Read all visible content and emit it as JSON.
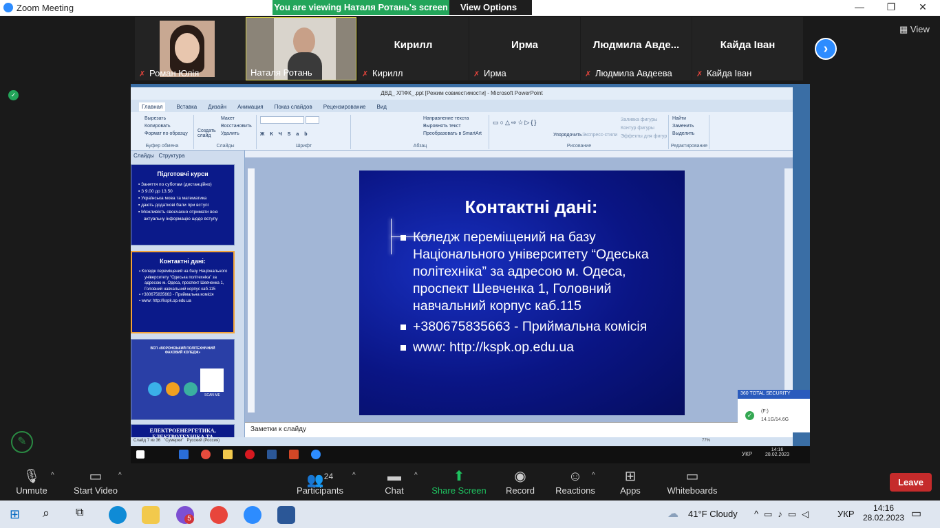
{
  "window": {
    "title": "Zoom Meeting",
    "minimize": "—",
    "restore": "❐",
    "close": "✕"
  },
  "banner": {
    "text": "You are viewing Наталя Ротань's screen",
    "view_options": "View Options"
  },
  "participants_strip": {
    "view_label": "View",
    "tiles": [
      {
        "name": "Роман Юлія",
        "muted": true
      },
      {
        "name": "Наталя Ротань",
        "muted": false
      },
      {
        "name": "Кирилл",
        "big_name": "Кирилл",
        "muted": true
      },
      {
        "name": "Ирма",
        "big_name": "Ирма",
        "muted": true
      },
      {
        "name": "Людмила Авдеева",
        "big_name": "Людмила Авде...",
        "muted": true
      },
      {
        "name": "Кайда Іван",
        "big_name": "Кайда Іван",
        "muted": true
      }
    ]
  },
  "ppt": {
    "title": "ДВД_ ХПФК_.ppt [Режим совместимости] - Microsoft PowerPoint",
    "tabs": [
      "Главная",
      "Вставка",
      "Дизайн",
      "Анимация",
      "Показ слайдов",
      "Рецензирование",
      "Вид"
    ],
    "ribbon_groups": [
      "Буфер обмена",
      "Слайды",
      "Шрифт",
      "Абзац",
      "Рисование",
      "Редактирование"
    ],
    "clipboard": [
      "Вырезать",
      "Копировать",
      "Формат по образцу"
    ],
    "slides_group": [
      "Создать слайд",
      "Макет",
      "Восстановить",
      "Удалить"
    ],
    "editing": [
      "Найти",
      "Заменить",
      "Выделить"
    ],
    "drawing": [
      "Упорядочить",
      "Экспресс-стили",
      "Заливка фигуры",
      "Контур фигуры",
      "Эффекты для фигур"
    ],
    "paragraph": [
      "Направление текста",
      "Выровнять текст",
      "Преобразовать в SmartArt"
    ],
    "panel_tabs": [
      "Слайды",
      "Структура"
    ],
    "thumbs": [
      {
        "title": "Підготовчі курси",
        "items": [
          "Заняття по суботам (дистанційно)",
          "З 9.00 до 13.50",
          "Українська мова та математика",
          "дають додаткові бали при вступі",
          "Можливість своєчасно отримати всю актуальну інформацію щодо вступу"
        ]
      },
      {
        "title": "Контактні дані:",
        "items": [
          "Коледж переміщений на базу Національного університету “Одеська політехніка” за адресою м. Одеса, проспект Шевченка 1, Головний навчальний корпус каб.115",
          "+380675835663 - Приймальна комісія",
          "www: http://kspk.op.edu.ua"
        ]
      },
      {
        "title": "ВСП «ВОРОНІЗЬКИЙ ПОЛІТЕХНІЧНИЙ ФАХОВИЙ КОЛЕДЖ»",
        "scan": "SCAN ME"
      },
      {
        "title": "ЕЛЕКТРОЕНЕРГЕТИКА, ЕЛЕКТРОТЕХНІКА ТА"
      }
    ],
    "slide": {
      "title": "Контактні дані:",
      "bullets": [
        "Коледж переміщений на базу Національного університету “Одеська політехніка” за адресою м. Одеса, проспект Шевченка 1, Головний навчальний корпус каб.115",
        "+380675835663 - Приймальна комісія",
        "www: http://kspk.op.edu.ua"
      ]
    },
    "notes_placeholder": "Заметки к слайду",
    "status": {
      "slide": "Слайд 7 из 36",
      "theme": "\"Сумерки\"",
      "lang": "Русский (Россия)",
      "zoom": "77%"
    }
  },
  "remote_taskbar": {
    "lang": "УКР",
    "time": "14:16",
    "date": "28.02.2023"
  },
  "security": {
    "title": "360 TOTAL SECURITY",
    "drive": "(F:)",
    "size": "14.1G/14.6G"
  },
  "toolbar": {
    "unmute": "Unmute",
    "start_video": "Start Video",
    "participants": "Participants",
    "participants_count": "24",
    "chat": "Chat",
    "share": "Share Screen",
    "record": "Record",
    "reactions": "Reactions",
    "apps": "Apps",
    "whiteboards": "Whiteboards",
    "leave": "Leave"
  },
  "win_taskbar": {
    "weather": "41°F  Cloudy",
    "lang": "УКР",
    "time": "14:16",
    "date": "28.02.2023",
    "badge": "5"
  }
}
